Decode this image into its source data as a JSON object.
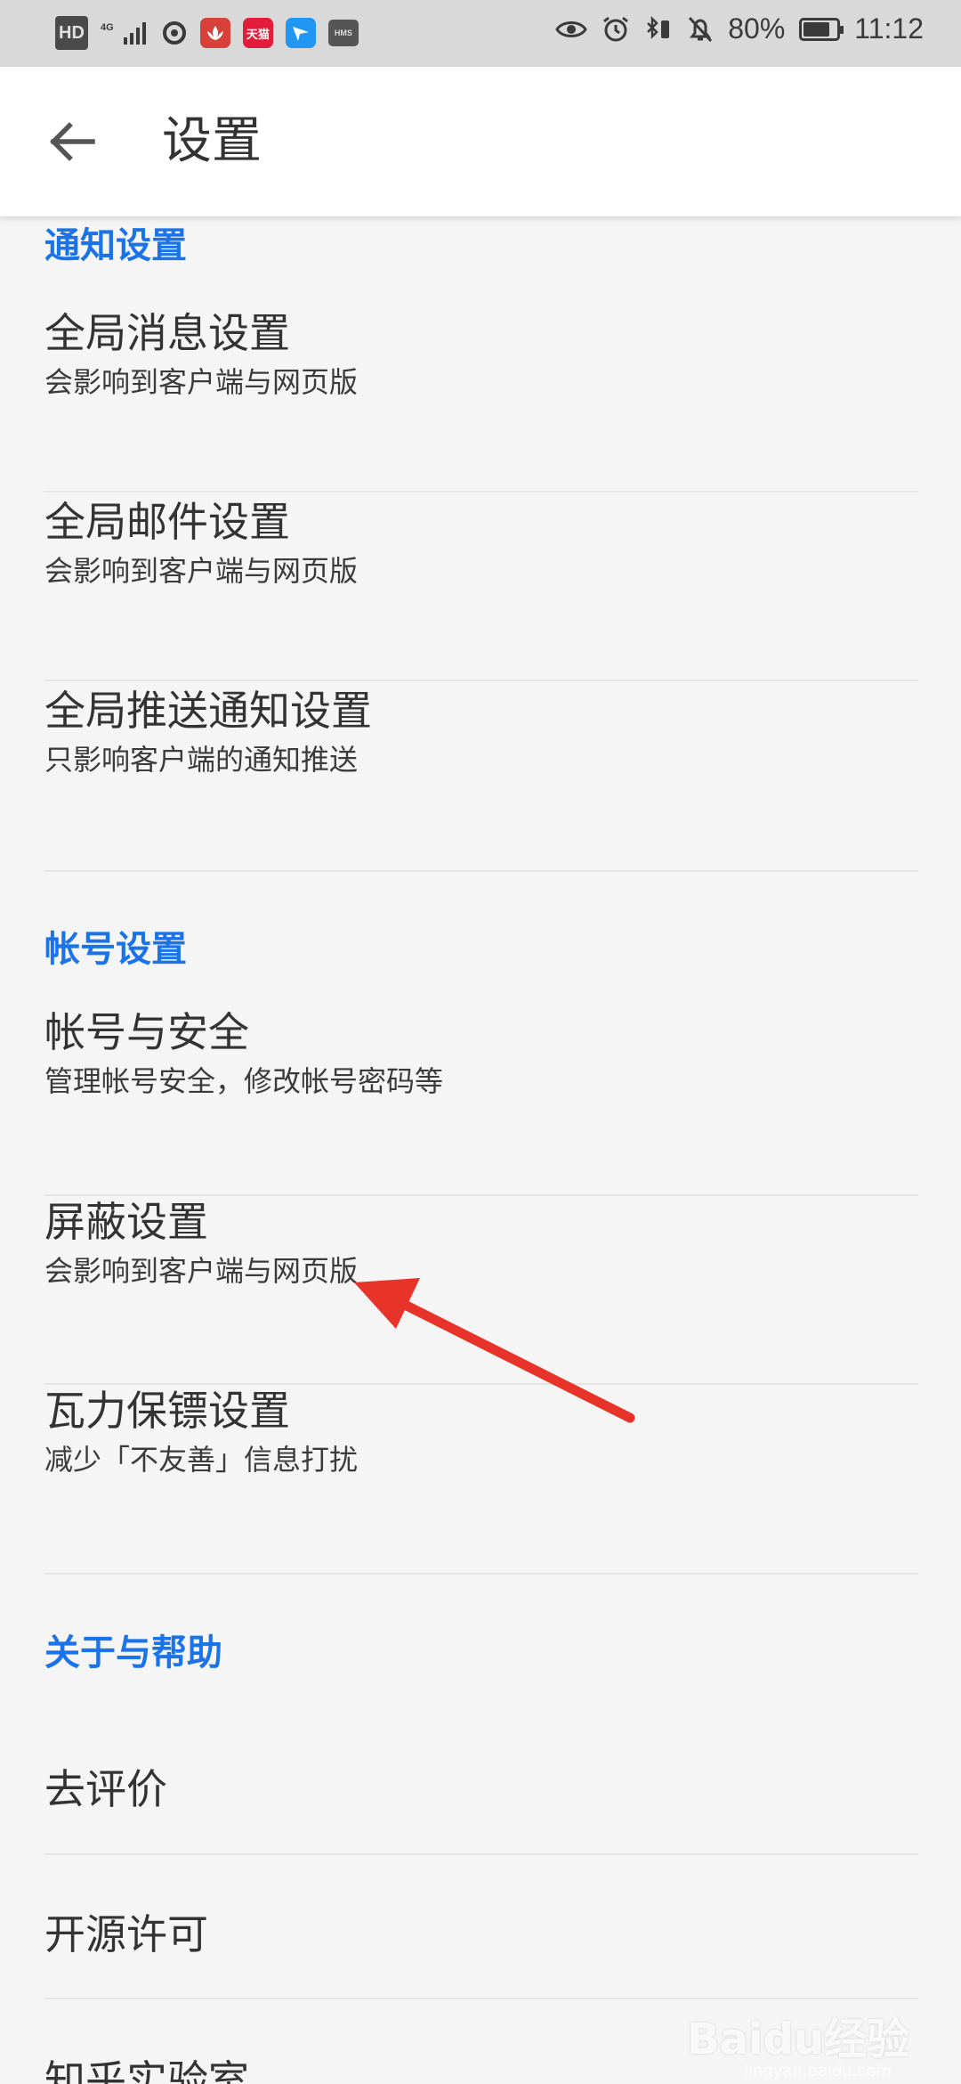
{
  "status_bar": {
    "hd": "HD",
    "network": "4G",
    "app_tmall": "天猫",
    "app_hms": "HMS",
    "battery": "80%",
    "battery_level": 0.8,
    "time": "11:12"
  },
  "app_bar": {
    "title": "设置"
  },
  "sections": {
    "notify": {
      "header": "通知设置",
      "items": [
        {
          "title": "全局消息设置",
          "subtitle": "会影响到客户端与网页版"
        },
        {
          "title": "全局邮件设置",
          "subtitle": "会影响到客户端与网页版"
        },
        {
          "title": "全局推送通知设置",
          "subtitle": "只影响客户端的通知推送"
        }
      ]
    },
    "account": {
      "header": "帐号设置",
      "items": [
        {
          "title": "帐号与安全",
          "subtitle": "管理帐号安全，修改帐号密码等"
        },
        {
          "title": "屏蔽设置",
          "subtitle": "会影响到客户端与网页版"
        },
        {
          "title": "瓦力保镖设置",
          "subtitle": "减少「不友善」信息打扰"
        }
      ]
    },
    "about": {
      "header": "关于与帮助",
      "items": [
        {
          "title": "去评价"
        },
        {
          "title": "开源许可"
        },
        {
          "title": "知乎实验室"
        }
      ]
    }
  },
  "colors": {
    "accent": "#1a73e8",
    "annotation": "#e8332a"
  },
  "watermark": {
    "brand": "Baidu经验",
    "url": "jingyan.baidu.com"
  }
}
